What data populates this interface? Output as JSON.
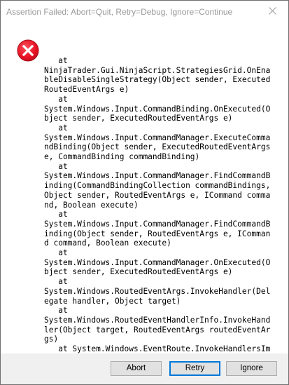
{
  "window": {
    "title": "Assertion Failed: Abort=Quit, Retry=Debug, Ignore=Continue"
  },
  "icons": {
    "error": "error-x-circle-icon",
    "close": "close-icon",
    "error_color": "#e81123"
  },
  "message": {
    "text": "   at\nNinjaTrader.Gui.NinjaScript.StrategiesGrid.OnEnableDisableSingleStrategy(Object sender, ExecutedRoutedEventArgs e)\n   at\nSystem.Windows.Input.CommandBinding.OnExecuted(Object sender, ExecutedRoutedEventArgs e)\n   at\nSystem.Windows.Input.CommandManager.ExecuteCommandBinding(Object sender, ExecutedRoutedEventArgs e, CommandBinding commandBinding)\n   at\nSystem.Windows.Input.CommandManager.FindCommandBinding(CommandBindingCollection commandBindings, Object sender, RoutedEventArgs e, ICommand command, Boolean execute)\n   at\nSystem.Windows.Input.CommandManager.FindCommandBinding(Object sender, RoutedEventArgs e, ICommand command, Boolean execute)\n   at\nSystem.Windows.Input.CommandManager.OnExecuted(Object sender, ExecutedRoutedEventArgs e)\n   at\nSystem.Windows.RoutedEventArgs.InvokeHandler(Delegate handler, Object target)\n   at\nSystem.Windows.RoutedEventHandlerInfo.InvokeHandler(Object target, RoutedEventArgs routedEventArgs)\n   at System.Windows.EventRoute.InvokeHandlersImpl(Object source, Rou......\n<truncated>"
  },
  "buttons": {
    "abort": "Abort",
    "retry": "Retry",
    "ignore": "Ignore"
  }
}
